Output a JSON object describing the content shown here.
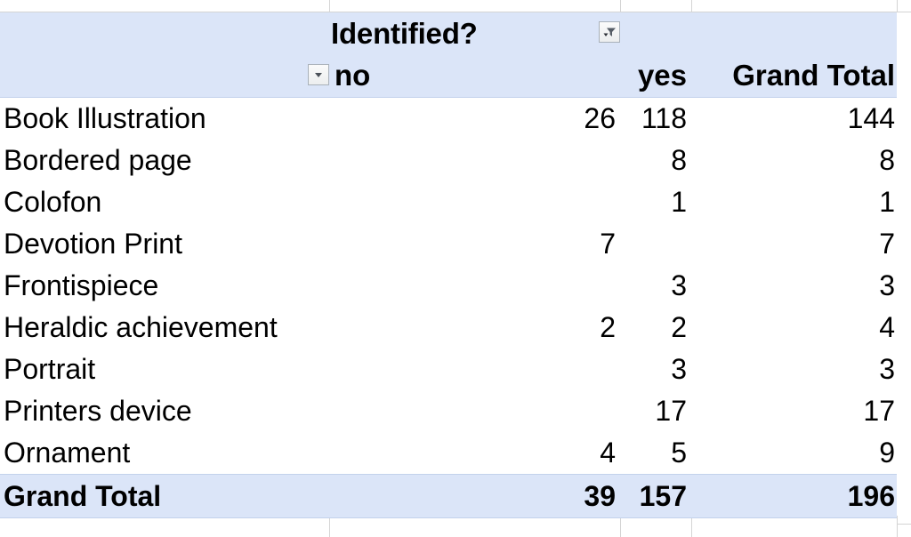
{
  "pivot": {
    "column_field_label": "Identified?",
    "filter_button_icon": "filter-funnel-icon",
    "row_field_dropdown_icon": "chevron-down-icon",
    "column_headers": [
      "no",
      "yes",
      "Grand Total"
    ],
    "rows": [
      {
        "label": "Book Illustration",
        "no": "26",
        "yes": "118",
        "total": "144"
      },
      {
        "label": "Bordered page",
        "no": "",
        "yes": "8",
        "total": "8"
      },
      {
        "label": "Colofon",
        "no": "",
        "yes": "1",
        "total": "1"
      },
      {
        "label": "Devotion Print",
        "no": "7",
        "yes": "",
        "total": "7"
      },
      {
        "label": "Frontispiece",
        "no": "",
        "yes": "3",
        "total": "3"
      },
      {
        "label": "Heraldic achievement",
        "no": "2",
        "yes": "2",
        "total": "4"
      },
      {
        "label": "Portrait",
        "no": "",
        "yes": "3",
        "total": "3"
      },
      {
        "label": "Printers device",
        "no": "",
        "yes": "17",
        "total": "17"
      },
      {
        "label": "Ornament",
        "no": "4",
        "yes": "5",
        "total": "9"
      }
    ],
    "grand_total": {
      "label": "Grand Total",
      "no": "39",
      "yes": "157",
      "total": "196"
    }
  },
  "colors": {
    "header_fill": "#dbe5f8",
    "gridline": "#d4d4d4",
    "text": "#000000"
  }
}
